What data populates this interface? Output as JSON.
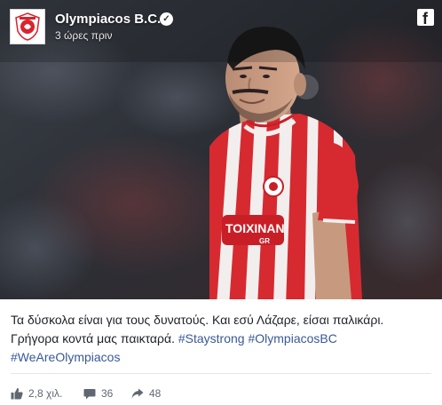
{
  "post": {
    "page_name": "Olympiacos B.C.",
    "timestamp": "3 ώρες πριν",
    "avatar_icon": "olympiacos-crest-icon",
    "verified_icon": "verified-badge-icon",
    "platform_icon": "facebook-logo-icon",
    "caption": {
      "line1": "Τα δύσκολα είναι για τους δυνατούς. Και εσύ Λάζαρε, είσαι παλικάρι.",
      "line2_text": "Γρήγορα κοντά μας παικταρά.",
      "hashtag_1": "#Staystrong",
      "hashtag_2": "#OlympiacosBC",
      "hashtag_3": "#WeAreOlympiacos"
    },
    "photo": {
      "jersey_sponsor": "TOIXINAN",
      "jersey_sponsor_suffix": "GR"
    },
    "stats": {
      "likes": "2,8 χιλ.",
      "comments": "36",
      "shares": "48"
    },
    "colors": {
      "brand_red": "#d9232d",
      "hashtag_blue": "#385898",
      "text": "#1d2129",
      "meta_gray": "#606770"
    }
  }
}
